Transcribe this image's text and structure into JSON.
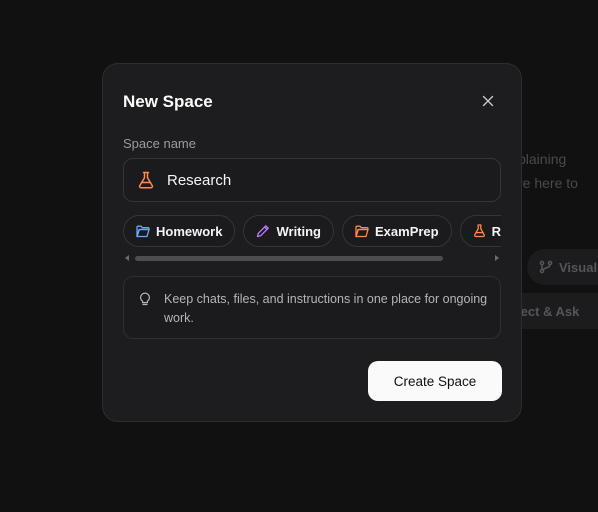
{
  "background": {
    "text_lines": [
      "plaining",
      "re here to"
    ],
    "pills": [
      "Visual",
      "lect & Ask"
    ]
  },
  "modal": {
    "title": "New Space",
    "close_icon": "close-icon",
    "name_label": "Space name",
    "name_value": "Research",
    "name_icon": "flask-icon",
    "chips": [
      {
        "label": "Homework",
        "icon": "folder-icon",
        "color": "#6aa8ff"
      },
      {
        "label": "Writing",
        "icon": "pencil-icon",
        "color": "#c07cff"
      },
      {
        "label": "ExamPrep",
        "icon": "folder-icon",
        "color": "#ff8a4c"
      },
      {
        "label": "Re",
        "icon": "flask-icon",
        "color": "#ff8a4c"
      }
    ],
    "hint_icon": "lightbulb-icon",
    "hint": "Keep chats, files, and instructions in one place for ongoing work.",
    "create_label": "Create Space"
  },
  "colors": {
    "accent_orange": "#ff8a4c",
    "accent_blue": "#6aa8ff",
    "accent_purple": "#c07cff",
    "modal_bg": "#1d1d1f",
    "button_bg": "#fafafa"
  }
}
